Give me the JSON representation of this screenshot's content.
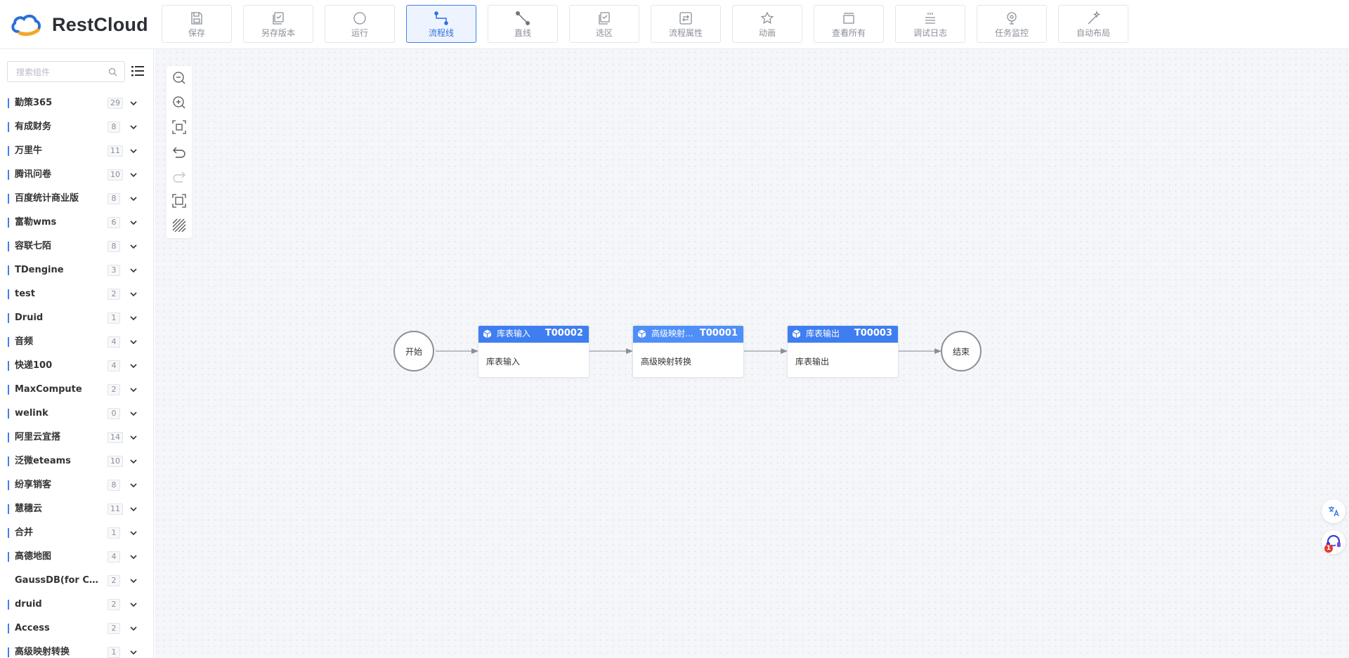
{
  "app": {
    "name": "RestCloud",
    "accent": "#3f7ef0"
  },
  "toolbar": {
    "buttons": [
      {
        "label": "保存",
        "icon": "save-icon"
      },
      {
        "label": "另存版本",
        "icon": "save-version-icon"
      },
      {
        "label": "运行",
        "icon": "run-icon"
      },
      {
        "label": "流程线",
        "icon": "flow-line-icon",
        "active": true
      },
      {
        "label": "直线",
        "icon": "straight-line-icon"
      },
      {
        "label": "选区",
        "icon": "select-area-icon"
      },
      {
        "label": "流程属性",
        "icon": "flow-properties-icon"
      },
      {
        "label": "动画",
        "icon": "animation-icon"
      },
      {
        "label": "查看所有",
        "icon": "view-all-icon"
      },
      {
        "label": "调试日志",
        "icon": "debug-log-icon"
      },
      {
        "label": "任务监控",
        "icon": "task-monitor-icon"
      },
      {
        "label": "自动布局",
        "icon": "auto-layout-icon"
      }
    ]
  },
  "sidebar": {
    "search_placeholder": "搜索组件",
    "categories": [
      {
        "name": "勤策365",
        "count": "29"
      },
      {
        "name": "有成财务",
        "count": "8"
      },
      {
        "name": "万里牛",
        "count": "11"
      },
      {
        "name": "腾讯问卷",
        "count": "10"
      },
      {
        "name": "百度统计商业版",
        "count": "8"
      },
      {
        "name": "富勒wms",
        "count": "6"
      },
      {
        "name": "容联七陌",
        "count": "8"
      },
      {
        "name": "TDengine",
        "count": "3"
      },
      {
        "name": "test",
        "count": "2"
      },
      {
        "name": "Druid",
        "count": "1"
      },
      {
        "name": "音频",
        "count": "4"
      },
      {
        "name": "快递100",
        "count": "4"
      },
      {
        "name": "MaxCompute",
        "count": "2"
      },
      {
        "name": "welink",
        "count": "0"
      },
      {
        "name": "阿里云宜搭",
        "count": "14"
      },
      {
        "name": "泛微eteams",
        "count": "10"
      },
      {
        "name": "纷享销客",
        "count": "8"
      },
      {
        "name": "慧穗云",
        "count": "11"
      },
      {
        "name": "合并",
        "count": "1"
      },
      {
        "name": "高德地图",
        "count": "4"
      },
      {
        "name": "GaussDB(for Cassandra)",
        "count": "2"
      },
      {
        "name": "druid",
        "count": "2"
      },
      {
        "name": "Access",
        "count": "2"
      },
      {
        "name": "高级映射转换",
        "count": "1"
      }
    ]
  },
  "flow": {
    "start_label": "开始",
    "end_label": "结束",
    "node_color": "#3f7ef0",
    "tasks": [
      {
        "title": "库表输入",
        "id": "T00002",
        "body": "库表输入"
      },
      {
        "title": "高级映射转换",
        "id": "T00001",
        "body": "高级映射转换"
      },
      {
        "title": "库表输出",
        "id": "T00003",
        "body": "库表输出"
      }
    ]
  },
  "floating": {
    "notification_count": "1"
  }
}
